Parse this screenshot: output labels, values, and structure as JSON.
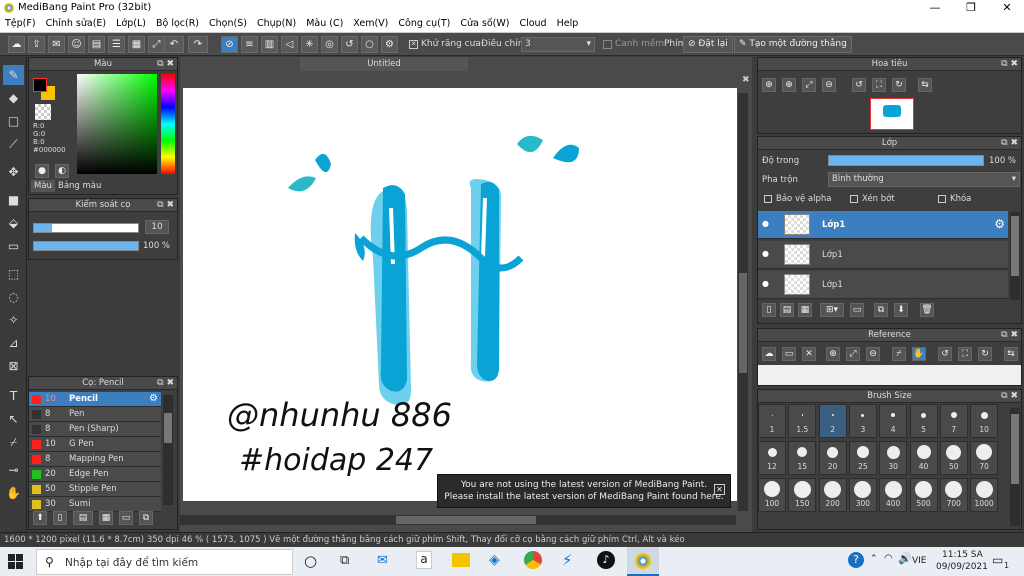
{
  "window": {
    "title": "MediBang Paint Pro (32bit)",
    "minimize": "—",
    "maximize": "❒",
    "close": "✕"
  },
  "menu": [
    "Tệp(F)",
    "Chỉnh sửa(E)",
    "Lớp(L)",
    "Bộ lọc(R)",
    "Chọn(S)",
    "Chụp(N)",
    "Màu (C)",
    "Xem(V)",
    "Công cụ(T)",
    "Cửa số(W)",
    "Cloud",
    "Help"
  ],
  "toolbar": {
    "antialias_label": "Khử răng cưa",
    "adjust_label": "Điều chỉnh",
    "adjust_value": "3",
    "snap_label": "Canh mềm",
    "key_label": "Phím",
    "reset_label": "Đặt lại",
    "ruler_label": "Tạo một đường thẳng"
  },
  "color_panel": {
    "title": "Màu",
    "r": "R:0",
    "g": "G:0",
    "b": "B:0",
    "hex": "#000000",
    "tab_color": "Màu",
    "tab_palette": "Bảng màu",
    "accent": "#000000"
  },
  "brush_control": {
    "title": "Kiểm soát cọ",
    "size": "10",
    "opacity": "100 %"
  },
  "brush_list": {
    "title": "Cọ: Pencil",
    "items": [
      {
        "size": "10",
        "name": "Pencil",
        "color": "#ff2020"
      },
      {
        "size": "8",
        "name": "Pen",
        "color": "#333333"
      },
      {
        "size": "8",
        "name": "Pen (Sharp)",
        "color": "#333333"
      },
      {
        "size": "10",
        "name": "G Pen",
        "color": "#ff2020"
      },
      {
        "size": "8",
        "name": "Mapping Pen",
        "color": "#ff2020"
      },
      {
        "size": "20",
        "name": "Edge Pen",
        "color": "#20c020"
      },
      {
        "size": "50",
        "name": "Stipple Pen",
        "color": "#e0c020"
      },
      {
        "size": "30",
        "name": "Sumi",
        "color": "#e0c020"
      }
    ]
  },
  "canvas": {
    "tab": "Untitled",
    "notice_line1": "You are not using the latest version of MediBang Paint.",
    "notice_line2": "Please install the latest version of MediBang Paint found here.",
    "watermark_line1": "@nhunhu 886",
    "watermark_line2": "#hoidap 247"
  },
  "navigator": {
    "title": "Hoa tiêu"
  },
  "layers": {
    "title": "Lớp",
    "opacity_label": "Độ trong",
    "opacity_value": "100 %",
    "blend_label": "Pha trộn",
    "blend_value": "Bình thường",
    "protect_alpha": "Bảo vệ alpha",
    "clipping": "Xén bớt",
    "lock": "Khóa",
    "items": [
      "Lớp1",
      "Lớp1",
      "Lớp1"
    ]
  },
  "reference": {
    "title": "Reference"
  },
  "brush_size": {
    "title": "Brush Size",
    "sizes": [
      "1",
      "1.5",
      "2",
      "3",
      "4",
      "5",
      "7",
      "10",
      "12",
      "15",
      "20",
      "25",
      "30",
      "40",
      "50",
      "70",
      "100",
      "150",
      "200",
      "300",
      "400",
      "500",
      "700",
      "1000"
    ]
  },
  "status": "1600 * 1200 pixel  (11.6 * 8.7cm)  350 dpi  46 %  ( 1573, 1075 )  Vẽ một đường thẳng bằng cách giữ phím Shift, Thay đổi cỡ cọ bằng cách giữ phím Ctrl, Alt và kéo",
  "taskbar": {
    "search_placeholder": "Nhập tại đây để tìm kiếm",
    "lang": "VIE",
    "time": "11:15 SA",
    "date": "09/09/2021",
    "notif": "1"
  }
}
